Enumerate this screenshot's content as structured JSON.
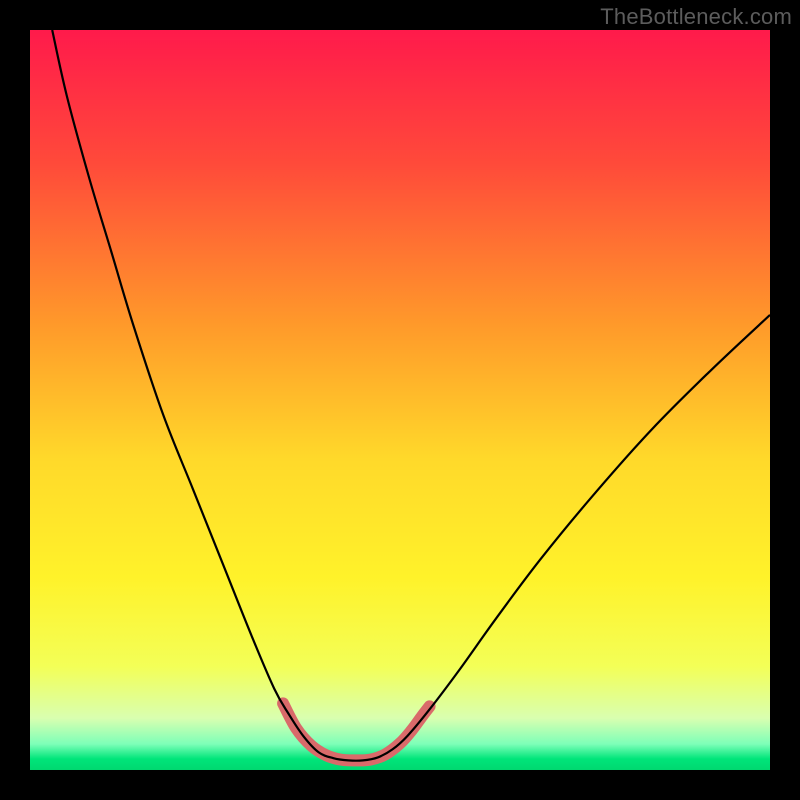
{
  "watermark": "TheBottleneck.com",
  "chart_data": {
    "type": "line",
    "title": "",
    "xlabel": "",
    "ylabel": "",
    "xlim": [
      0,
      100
    ],
    "ylim": [
      0,
      100
    ],
    "gradient_stops": [
      {
        "offset": 0.0,
        "color": "#ff1a4b"
      },
      {
        "offset": 0.18,
        "color": "#ff4a3a"
      },
      {
        "offset": 0.4,
        "color": "#ff9a2a"
      },
      {
        "offset": 0.58,
        "color": "#ffd92a"
      },
      {
        "offset": 0.74,
        "color": "#fff22a"
      },
      {
        "offset": 0.86,
        "color": "#f3ff57"
      },
      {
        "offset": 0.93,
        "color": "#d9ffb0"
      },
      {
        "offset": 0.965,
        "color": "#7dffb8"
      },
      {
        "offset": 0.985,
        "color": "#00e57a"
      },
      {
        "offset": 1.0,
        "color": "#00d870"
      }
    ],
    "series": [
      {
        "name": "bottleneck-curve",
        "stroke": "#000000",
        "stroke_width": 2.2,
        "points": [
          {
            "x": 3.0,
            "y": 100.0
          },
          {
            "x": 5.0,
            "y": 91.0
          },
          {
            "x": 8.0,
            "y": 80.0
          },
          {
            "x": 11.0,
            "y": 70.0
          },
          {
            "x": 14.0,
            "y": 60.0
          },
          {
            "x": 18.0,
            "y": 48.0
          },
          {
            "x": 22.0,
            "y": 38.0
          },
          {
            "x": 26.0,
            "y": 28.0
          },
          {
            "x": 30.0,
            "y": 18.0
          },
          {
            "x": 33.0,
            "y": 11.0
          },
          {
            "x": 35.0,
            "y": 7.5
          },
          {
            "x": 37.0,
            "y": 4.5
          },
          {
            "x": 39.0,
            "y": 2.4
          },
          {
            "x": 41.0,
            "y": 1.6
          },
          {
            "x": 43.0,
            "y": 1.3
          },
          {
            "x": 45.0,
            "y": 1.3
          },
          {
            "x": 47.0,
            "y": 1.7
          },
          {
            "x": 49.0,
            "y": 2.8
          },
          {
            "x": 51.0,
            "y": 4.6
          },
          {
            "x": 54.0,
            "y": 8.2
          },
          {
            "x": 58.0,
            "y": 13.5
          },
          {
            "x": 63.0,
            "y": 20.5
          },
          {
            "x": 69.0,
            "y": 28.5
          },
          {
            "x": 76.0,
            "y": 37.0
          },
          {
            "x": 84.0,
            "y": 46.0
          },
          {
            "x": 92.0,
            "y": 54.0
          },
          {
            "x": 100.0,
            "y": 61.5
          }
        ]
      },
      {
        "name": "optimal-zone-highlight",
        "stroke": "#d96a6a",
        "stroke_width": 12,
        "linecap": "round",
        "points": [
          {
            "x": 34.2,
            "y": 9.0
          },
          {
            "x": 36.0,
            "y": 5.6
          },
          {
            "x": 38.0,
            "y": 3.3
          },
          {
            "x": 40.0,
            "y": 2.0
          },
          {
            "x": 42.0,
            "y": 1.4
          },
          {
            "x": 44.0,
            "y": 1.3
          },
          {
            "x": 46.0,
            "y": 1.4
          },
          {
            "x": 48.0,
            "y": 2.1
          },
          {
            "x": 50.0,
            "y": 3.6
          },
          {
            "x": 51.6,
            "y": 5.4
          },
          {
            "x": 53.0,
            "y": 7.3
          },
          {
            "x": 54.0,
            "y": 8.6
          }
        ]
      }
    ]
  }
}
